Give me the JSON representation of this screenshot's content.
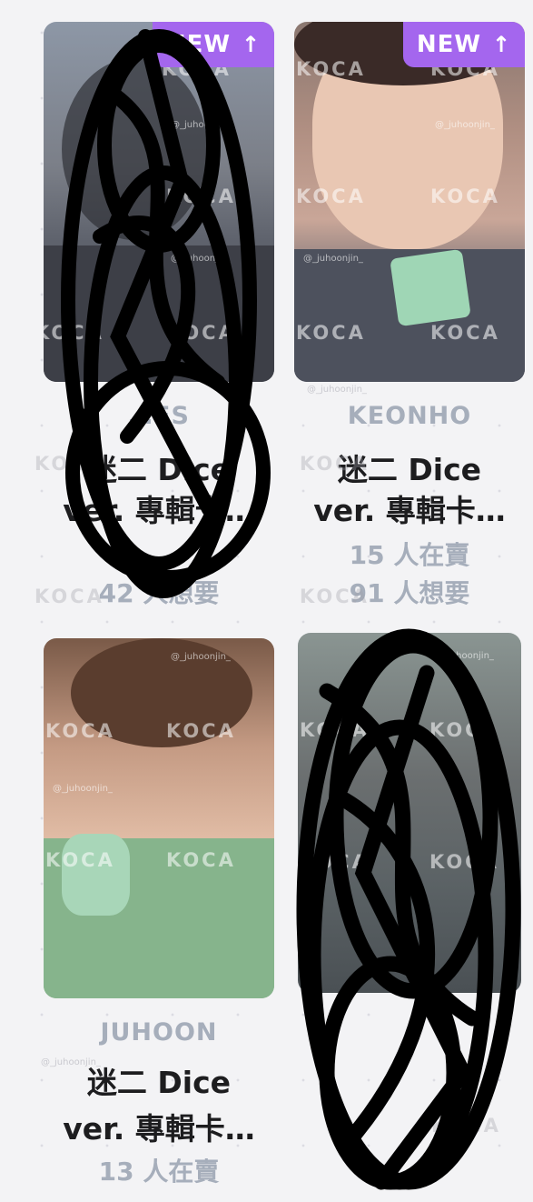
{
  "colors": {
    "background": "#f3f3f5",
    "badge": "#a466ee",
    "muted_text": "#a6aebb",
    "title_text": "#1d1d1f"
  },
  "watermark": {
    "brand": "KOCA",
    "handle": "@_juhoonjin_"
  },
  "cards": [
    {
      "badge": "NEW",
      "badge_icon": "arrow-up-icon",
      "artist": "…ES",
      "title_line1": "迷二 Dice",
      "title_line2": "ver. 專輯卡…",
      "selling": "",
      "wanting": "42 人想要"
    },
    {
      "badge": "NEW",
      "badge_icon": "arrow-up-icon",
      "artist": "KEONHO",
      "title_line1": "迷二 Dice",
      "title_line2": "ver. 專輯卡…",
      "selling": "15 人在賣",
      "wanting": "91 人想要"
    },
    {
      "badge": "",
      "artist": "JUHOON",
      "title_line1": "迷二 Dice",
      "title_line2": "ver. 專輯卡…",
      "selling": "13 人在賣",
      "wanting": ""
    },
    {
      "badge": "",
      "artist": "",
      "title_line1": "",
      "title_line2": "",
      "selling": "",
      "wanting": ""
    }
  ]
}
